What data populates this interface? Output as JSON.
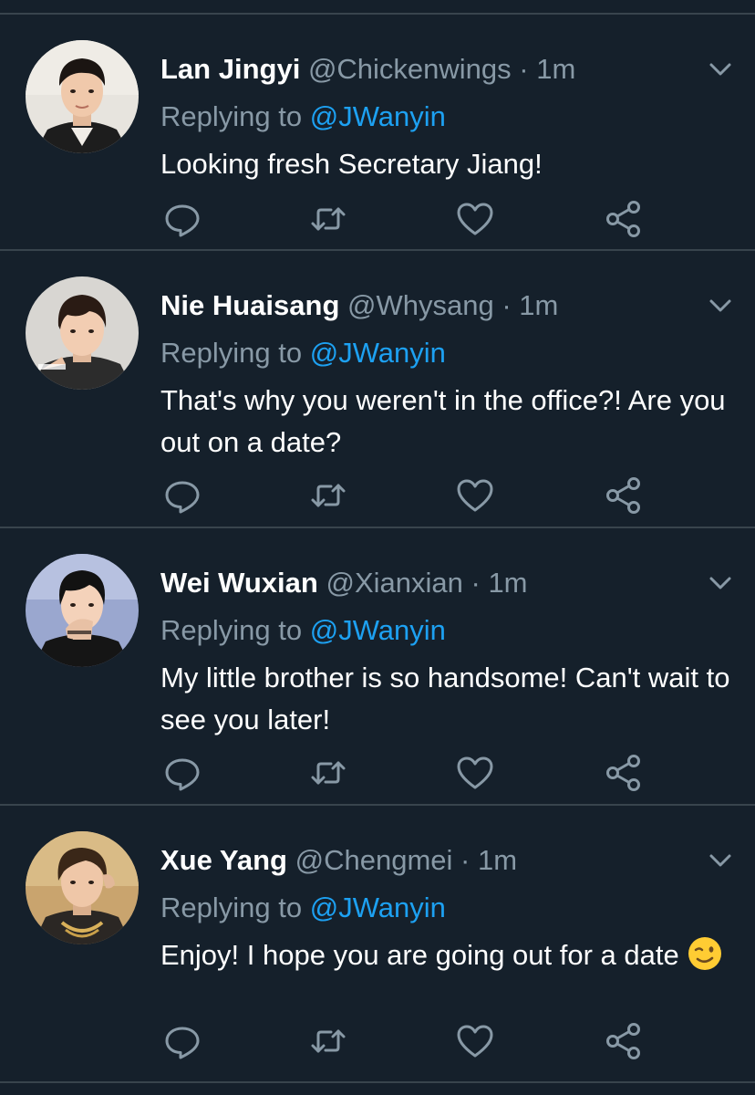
{
  "tweets": [
    {
      "name": "Lan Jingyi",
      "handle": "@Chickenwings",
      "separator": "·",
      "time": "1m",
      "replying_prefix": "Replying to ",
      "replying_to": "@JWanyin",
      "text": "Looking fresh Secretary Jiang!",
      "emoji": ""
    },
    {
      "name": "Nie Huaisang",
      "handle": "@Whysang",
      "separator": "·",
      "time": "1m",
      "replying_prefix": "Replying to ",
      "replying_to": "@JWanyin",
      "text": "That's why you weren't in the office?! Are you out on a date?",
      "emoji": ""
    },
    {
      "name": "Wei Wuxian",
      "handle": "@Xianxian",
      "separator": "·",
      "time": "1m",
      "replying_prefix": "Replying to ",
      "replying_to": "@JWanyin",
      "text": "My little brother is so handsome! Can't wait to see you later!",
      "emoji": ""
    },
    {
      "name": "Xue Yang",
      "handle": "@Chengmei",
      "separator": "·",
      "time": "1m",
      "replying_prefix": "Replying to ",
      "replying_to": "@JWanyin",
      "text": "Enjoy! I hope you are going out for a date",
      "emoji": "winking-face"
    }
  ],
  "icons": {
    "reply": "reply-icon",
    "retweet": "retweet-icon",
    "like": "heart-icon",
    "share": "share-icon",
    "menu": "chevron-down-icon"
  },
  "colors": {
    "background": "#15202b",
    "divider": "#38444d",
    "name": "#ffffff",
    "secondary_text": "#8899a6",
    "mention": "#1da1f2",
    "icon": "#8899a6"
  }
}
